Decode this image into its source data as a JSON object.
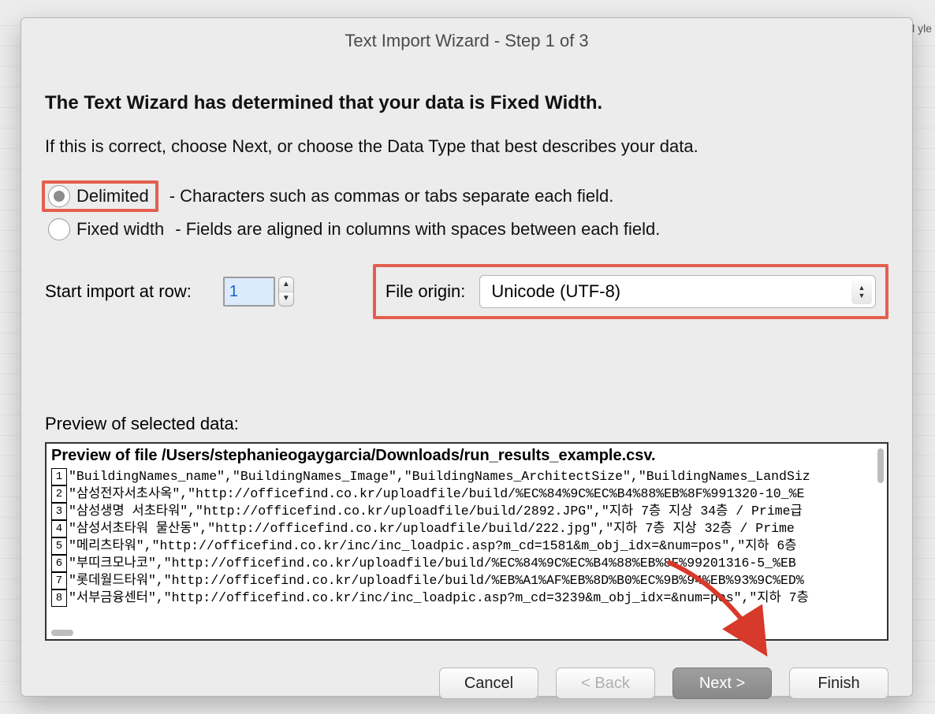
{
  "backdrop_hint": "el\nyle",
  "dialog": {
    "title": "Text Import Wizard - Step 1 of 3",
    "heading": "The Text Wizard has determined that your data is Fixed Width.",
    "subheading": "If this is correct, choose Next, or choose the Data Type that best describes your data.",
    "delimited": {
      "label": "Delimited",
      "desc": "- Characters such as commas or tabs separate each field."
    },
    "fixed": {
      "label": "Fixed width",
      "desc": "- Fields are aligned in columns with spaces between each field."
    },
    "start_row_label": "Start import at row:",
    "start_row_value": "1",
    "origin_label": "File origin:",
    "origin_value": "Unicode (UTF-8)",
    "preview_label": "Preview of selected data:",
    "preview_title": "Preview of file /Users/stephanieogaygarcia/Downloads/run_results_example.csv.",
    "preview_lines": [
      "\"BuildingNames_name\",\"BuildingNames_Image\",\"BuildingNames_ArchitectSize\",\"BuildingNames_LandSiz",
      "\"삼성전자서초사옥\",\"http://officefind.co.kr/uploadfile/build/%EC%84%9C%EC%B4%88%EB%8F%991320-10_%E",
      "\"삼성생명 서초타워\",\"http://officefind.co.kr/uploadfile/build/2892.JPG\",\"지하 7층 지상 34층 / Prime급",
      "\"삼성서초타워 물산동\",\"http://officefind.co.kr/uploadfile/build/222.jpg\",\"지하 7층 지상 32층 / Prime",
      "\"메리츠타워\",\"http://officefind.co.kr/inc/inc_loadpic.asp?m_cd=1581&m_obj_idx=&num=pos\",\"지하 6층",
      "\"부띠크모나코\",\"http://officefind.co.kr/uploadfile/build/%EC%84%9C%EC%B4%88%EB%8F%99201316-5_%EB",
      "\"롯데월드타워\",\"http://officefind.co.kr/uploadfile/build/%EB%A1%AF%EB%8D%B0%EC%9B%94%EB%93%9C%ED%",
      "\"서부금융센터\",\"http://officefind.co.kr/inc/inc_loadpic.asp?m_cd=3239&m_obj_idx=&num=pos\",\"지하 7층"
    ],
    "buttons": {
      "cancel": "Cancel",
      "back": "< Back",
      "next": "Next >",
      "finish": "Finish"
    }
  }
}
